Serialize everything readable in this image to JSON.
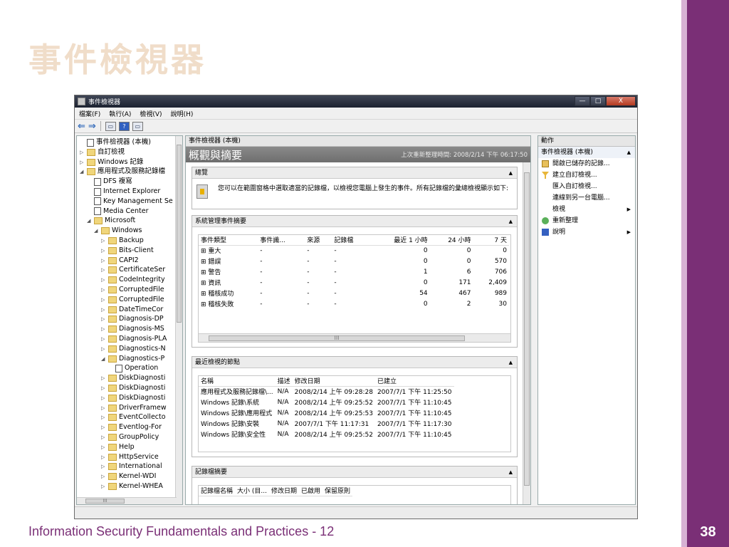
{
  "slide": {
    "title": "事件檢視器",
    "footer": "Information Security Fundamentals and Practices - 12",
    "page_number": "38"
  },
  "window": {
    "title": "事件檢視器",
    "buttons": {
      "minimize": "—",
      "maximize": "□",
      "close": "X"
    }
  },
  "menubar": [
    "檔案(F)",
    "執行(A)",
    "檢視(V)",
    "說明(H)"
  ],
  "toolbar": {
    "back": "⇐",
    "forward": "⇒",
    "box1": "▭",
    "help": "?",
    "box2": "▭"
  },
  "tree": {
    "items": [
      {
        "label": "事件檢視器 (本機)",
        "icon": "log-icon",
        "level": 0,
        "exp": ""
      },
      {
        "label": "自訂檢視",
        "icon": "folder-icon",
        "level": 0,
        "exp": "▷"
      },
      {
        "label": "Windows 記錄",
        "icon": "folder-icon",
        "level": 0,
        "exp": "▷"
      },
      {
        "label": "應用程式及服務記錄檔",
        "icon": "folder-icon",
        "level": 0,
        "exp": "◢"
      },
      {
        "label": "DFS 複寫",
        "icon": "log-icon",
        "level": 1,
        "exp": ""
      },
      {
        "label": "Internet Explorer",
        "icon": "log-icon",
        "level": 1,
        "exp": ""
      },
      {
        "label": "Key Management Se",
        "icon": "log-icon",
        "level": 1,
        "exp": ""
      },
      {
        "label": "Media Center",
        "icon": "log-icon",
        "level": 1,
        "exp": ""
      },
      {
        "label": "Microsoft",
        "icon": "folder-icon",
        "level": 1,
        "exp": "◢"
      },
      {
        "label": "Windows",
        "icon": "folder-icon",
        "level": 2,
        "exp": "◢"
      },
      {
        "label": "Backup",
        "icon": "folder-icon",
        "level": 3,
        "exp": "▷"
      },
      {
        "label": "Bits-Client",
        "icon": "folder-icon",
        "level": 3,
        "exp": "▷"
      },
      {
        "label": "CAPI2",
        "icon": "folder-icon",
        "level": 3,
        "exp": "▷"
      },
      {
        "label": "CertificateSer",
        "icon": "folder-icon",
        "level": 3,
        "exp": "▷"
      },
      {
        "label": "CodeIntegrity",
        "icon": "folder-icon",
        "level": 3,
        "exp": "▷"
      },
      {
        "label": "CorruptedFile",
        "icon": "folder-icon",
        "level": 3,
        "exp": "▷"
      },
      {
        "label": "CorruptedFile",
        "icon": "folder-icon",
        "level": 3,
        "exp": "▷"
      },
      {
        "label": "DateTimeCor",
        "icon": "folder-icon",
        "level": 3,
        "exp": "▷"
      },
      {
        "label": "Diagnosis-DP",
        "icon": "folder-icon",
        "level": 3,
        "exp": "▷"
      },
      {
        "label": "Diagnosis-MS",
        "icon": "folder-icon",
        "level": 3,
        "exp": "▷"
      },
      {
        "label": "Diagnosis-PLA",
        "icon": "folder-icon",
        "level": 3,
        "exp": "▷"
      },
      {
        "label": "Diagnostics-N",
        "icon": "folder-icon",
        "level": 3,
        "exp": "▷"
      },
      {
        "label": "Diagnostics-P",
        "icon": "folder-icon",
        "level": 3,
        "exp": "◢"
      },
      {
        "label": "Operation",
        "icon": "log-icon",
        "level": 4,
        "exp": ""
      },
      {
        "label": "DiskDiagnosti",
        "icon": "folder-icon",
        "level": 3,
        "exp": "▷"
      },
      {
        "label": "DiskDiagnosti",
        "icon": "folder-icon",
        "level": 3,
        "exp": "▷"
      },
      {
        "label": "DiskDiagnosti",
        "icon": "folder-icon",
        "level": 3,
        "exp": "▷"
      },
      {
        "label": "DriverFramew",
        "icon": "folder-icon",
        "level": 3,
        "exp": "▷"
      },
      {
        "label": "EventCollecto",
        "icon": "folder-icon",
        "level": 3,
        "exp": "▷"
      },
      {
        "label": "Eventlog-For",
        "icon": "folder-icon",
        "level": 3,
        "exp": "▷"
      },
      {
        "label": "GroupPolicy",
        "icon": "folder-icon",
        "level": 3,
        "exp": "▷"
      },
      {
        "label": "Help",
        "icon": "folder-icon",
        "level": 3,
        "exp": "▷"
      },
      {
        "label": "HttpService",
        "icon": "folder-icon",
        "level": 3,
        "exp": "▷"
      },
      {
        "label": "International",
        "icon": "folder-icon",
        "level": 3,
        "exp": "▷"
      },
      {
        "label": "Kernel-WDI",
        "icon": "folder-icon",
        "level": 3,
        "exp": "▷"
      },
      {
        "label": "Kernel-WHEA",
        "icon": "folder-icon",
        "level": 3,
        "exp": "▷"
      }
    ],
    "hscroll_label": "III"
  },
  "center": {
    "header": "事件檢視器 (本機)",
    "banner_title": "概觀與摘要",
    "banner_refresh": "上次重新整理時間: 2008/2/14 下午 06:17:50",
    "overview": {
      "title": "總覽",
      "text": "您可以在範圍窗格中選取適當的記錄檔，以檢視您電腦上發生的事件。所有記錄檔的彙總檢視顯示如下:"
    },
    "summary": {
      "title": "系統管理事件摘要",
      "columns": [
        "事件類型",
        "事件識...",
        "來源",
        "記錄檔",
        "最近 1 小時",
        "24 小時",
        "7 天"
      ],
      "rows": [
        [
          "⊞ 重大",
          "-",
          "-",
          "-",
          "0",
          "0",
          "0"
        ],
        [
          "⊞ 錯誤",
          "-",
          "-",
          "-",
          "0",
          "0",
          "570"
        ],
        [
          "⊞ 警告",
          "-",
          "-",
          "-",
          "1",
          "6",
          "706"
        ],
        [
          "⊞ 資訊",
          "-",
          "-",
          "-",
          "0",
          "171",
          "2,409"
        ],
        [
          "⊞ 稽核成功",
          "-",
          "-",
          "-",
          "54",
          "467",
          "989"
        ],
        [
          "⊞ 稽核失敗",
          "-",
          "-",
          "-",
          "0",
          "2",
          "30"
        ]
      ],
      "hscroll_label": "III"
    },
    "recent": {
      "title": "最近檢視的節點",
      "columns": [
        "名稱",
        "描述",
        "修改日期",
        "已建立"
      ],
      "rows": [
        [
          "應用程式及服務記錄檔\\...",
          "N/A",
          "2008/2/14 上午 09:28:28",
          "2007/7/1 下午 11:25:50"
        ],
        [
          "Windows 記錄\\系統",
          "N/A",
          "2008/2/14 上午 09:25:52",
          "2007/7/1 下午 11:10:45"
        ],
        [
          "Windows 記錄\\應用程式",
          "N/A",
          "2008/2/14 上午 09:25:53",
          "2007/7/1 下午 11:10:45"
        ],
        [
          "Windows 記錄\\安裝",
          "N/A",
          "2007/7/1 下午 11:17:31",
          "2007/7/1 下午 11:17:30"
        ],
        [
          "Windows 記錄\\安全性",
          "N/A",
          "2008/2/14 上午 09:25:52",
          "2007/7/1 下午 11:10:45"
        ]
      ]
    },
    "logs": {
      "title": "記錄檔摘要",
      "columns": [
        "記錄檔名稱",
        "大小 (目...",
        "修改日期",
        "已啟用",
        "保留原則"
      ]
    }
  },
  "actions": {
    "header": "動作",
    "group": "事件檢視器 (本機)",
    "items": [
      {
        "label": "開啟已儲存的記錄...",
        "icon": "open-log-icon"
      },
      {
        "label": "建立自訂檢視...",
        "icon": "filter-icon"
      },
      {
        "label": "匯入自訂檢視...",
        "icon": ""
      },
      {
        "label": "連線到另一台電腦...",
        "icon": ""
      },
      {
        "label": "檢視",
        "icon": "",
        "submenu": true
      },
      {
        "label": "重新整理",
        "icon": "refresh-icon"
      },
      {
        "label": "說明",
        "icon": "help-icon",
        "submenu": true
      }
    ]
  },
  "colors": {
    "slide_title": "#f0ddc9",
    "slide_accent": "#7a2f76",
    "banner": "#7a7a7a"
  }
}
